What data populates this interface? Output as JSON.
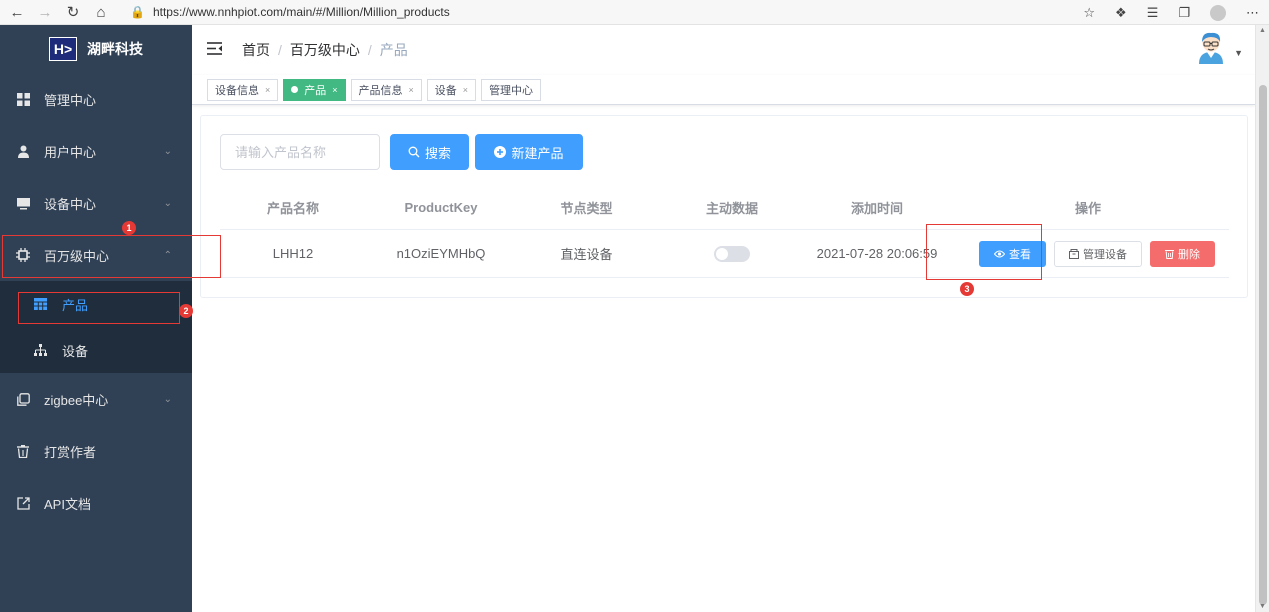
{
  "browser": {
    "url": "https://www.nnhpiot.com/main/#/Million/Million_products"
  },
  "sidebar": {
    "logo_mark": "H>",
    "logo_text": "湖畔科技",
    "items": [
      {
        "label": "管理中心",
        "icon": "grid-icon"
      },
      {
        "label": "用户中心",
        "icon": "user-icon"
      },
      {
        "label": "设备中心",
        "icon": "monitor-icon"
      },
      {
        "label": "百万级中心",
        "icon": "chip-icon"
      },
      {
        "label": "zigbee中心",
        "icon": "copy-icon"
      },
      {
        "label": "打赏作者",
        "icon": "trash-icon"
      },
      {
        "label": "API文档",
        "icon": "external-link-icon"
      }
    ],
    "sub_items": [
      {
        "label": "产品",
        "icon": "table-icon",
        "active": true
      },
      {
        "label": "设备",
        "icon": "sitemap-icon",
        "active": false
      }
    ]
  },
  "header": {
    "breadcrumb": [
      "首页",
      "百万级中心",
      "产品"
    ]
  },
  "tags": [
    {
      "label": "设备信息",
      "active": false
    },
    {
      "label": "产品",
      "active": true
    },
    {
      "label": "产品信息",
      "active": false
    },
    {
      "label": "设备",
      "active": false
    },
    {
      "label": "管理中心",
      "active": false,
      "closable": false
    }
  ],
  "main": {
    "search_placeholder": "请输入产品名称",
    "search_button": "搜索",
    "new_button": "新建产品",
    "table": {
      "headers": [
        "产品名称",
        "ProductKey",
        "节点类型",
        "主动数据",
        "添加时间",
        "操作"
      ],
      "rows": [
        {
          "name": "LHH12",
          "product_key": "n1OziEYMHbQ",
          "node_type": "直连设备",
          "active_data": false,
          "added_time": "2021-07-28 20:06:59",
          "actions": [
            "查看",
            "管理设备",
            "删除"
          ]
        }
      ]
    }
  },
  "annotations": [
    "1",
    "2",
    "3"
  ],
  "colors": {
    "sidebar_bg": "#304156",
    "primary": "#409eff",
    "success_tag": "#42b983",
    "danger": "#f56c6c",
    "annotation": "#e53935"
  }
}
